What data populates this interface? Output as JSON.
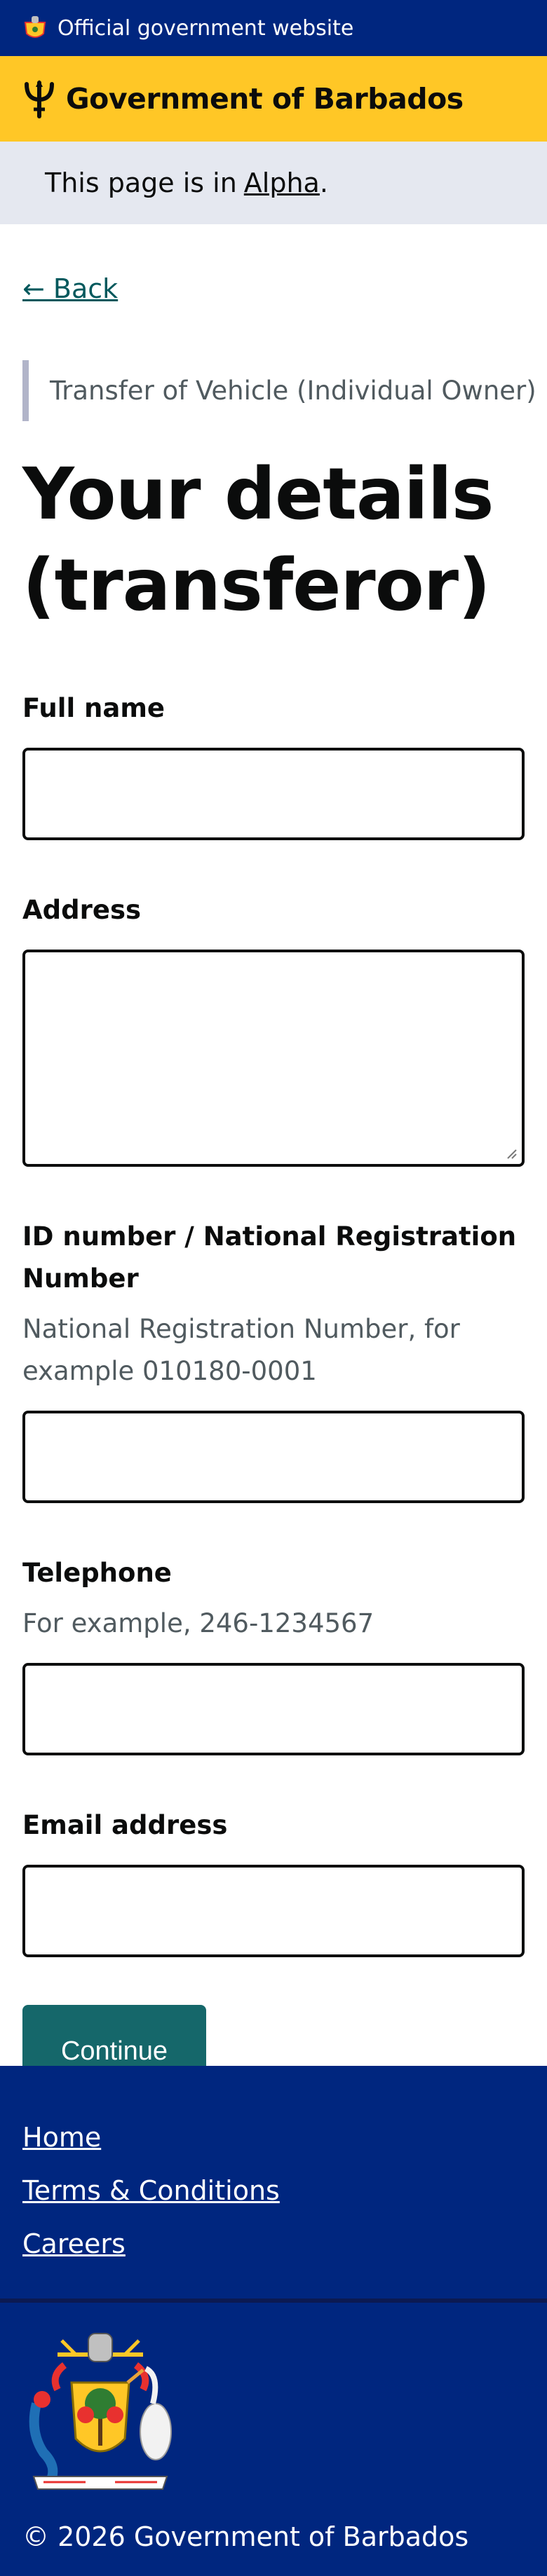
{
  "official_bar": {
    "text": "Official government website",
    "icon": "barbados-crest-icon"
  },
  "brand": {
    "name": "Government of Barbados",
    "icon": "trident-icon",
    "accent": "#ffc726"
  },
  "phase_banner": {
    "prefix": "This page is in",
    "tag": "Alpha",
    "suffix": "."
  },
  "back": {
    "label": "← Back"
  },
  "caption": "Transfer of Vehicle (Individual Owner)",
  "heading": "Your details (transferor)",
  "form": {
    "full_name": {
      "label": "Full name",
      "value": ""
    },
    "address": {
      "label": "Address",
      "value": ""
    },
    "id_number": {
      "label": "ID number / National Registration Number",
      "hint": "National Registration Number, for example 010180-0001",
      "value": ""
    },
    "telephone": {
      "label": "Telephone",
      "hint": "For example, 246-1234567",
      "value": ""
    },
    "email": {
      "label": "Email address",
      "value": ""
    },
    "submit_label": "Continue"
  },
  "footer": {
    "links": [
      "Home",
      "Terms & Conditions",
      "Careers"
    ],
    "copyright": "© 2026 Government of Barbados",
    "coat_of_arms_icon": "coat-of-arms-icon",
    "background": "#00267f"
  },
  "colors": {
    "primary_navy": "#00267f",
    "button": "#15676a",
    "link": "#00585c"
  }
}
